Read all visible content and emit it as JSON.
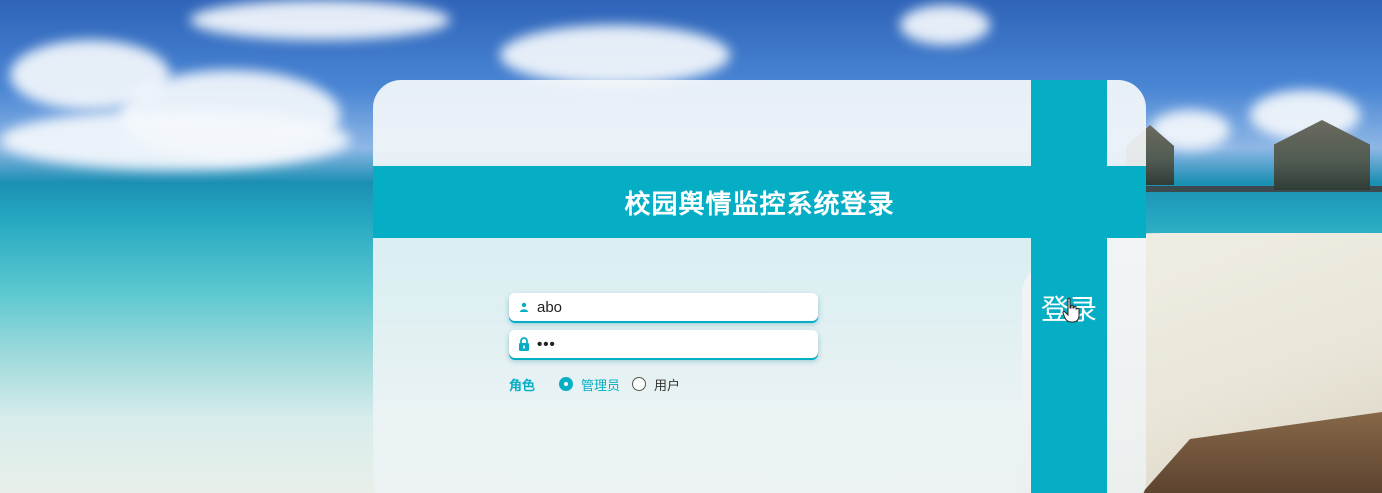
{
  "title": "校园舆情监控系统登录",
  "login_button": {
    "label": "登录"
  },
  "form": {
    "username": {
      "value": "abo",
      "icon": "user-icon"
    },
    "password": {
      "value": "•••",
      "icon": "lock-icon"
    },
    "role": {
      "label": "角色",
      "options": [
        {
          "label": "管理员",
          "checked": true
        },
        {
          "label": "用户",
          "checked": false
        }
      ]
    }
  },
  "colors": {
    "accent": "#06aec5",
    "text_on_accent": "#ffffff"
  },
  "icons": [
    "user-icon",
    "lock-icon",
    "hand-cursor-icon"
  ]
}
